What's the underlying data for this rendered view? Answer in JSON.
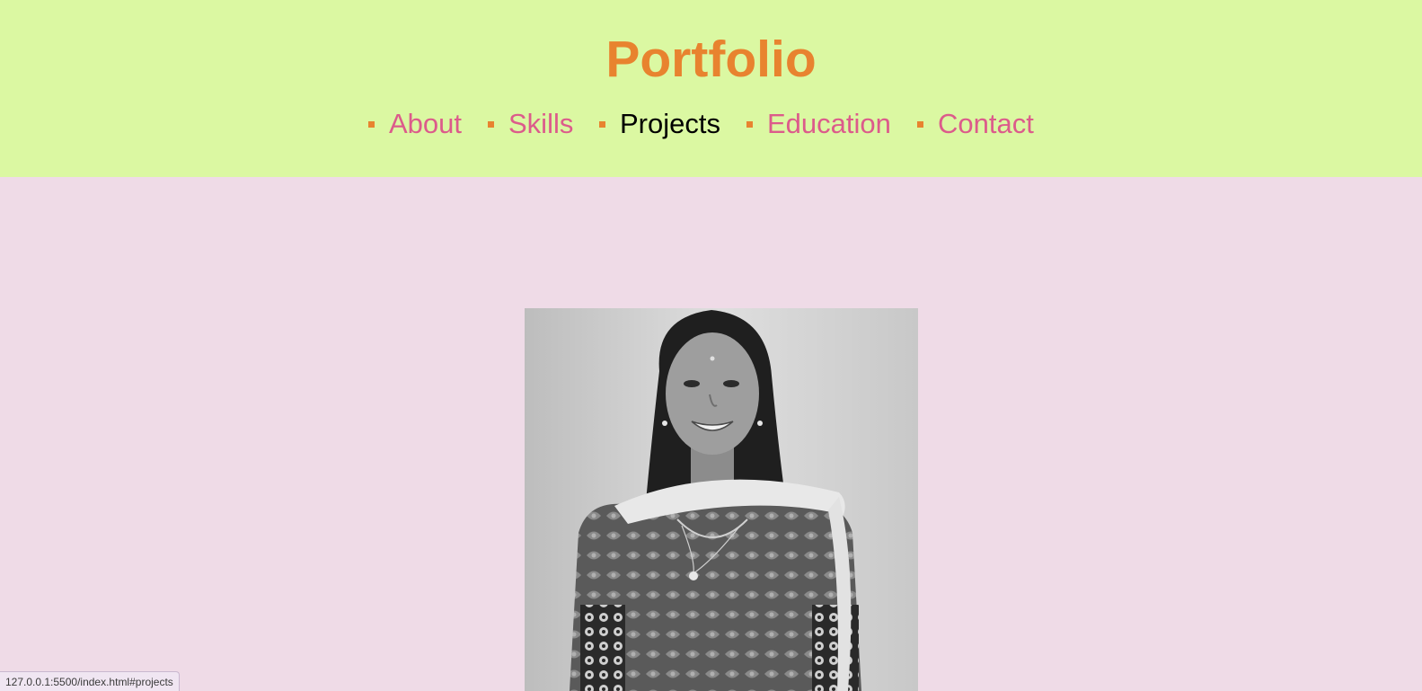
{
  "header": {
    "title": "Portfolio",
    "nav": [
      {
        "label": "About",
        "active": false
      },
      {
        "label": "Skills",
        "active": false
      },
      {
        "label": "Projects",
        "active": true
      },
      {
        "label": "Education",
        "active": false
      },
      {
        "label": "Contact",
        "active": false
      }
    ]
  },
  "main": {
    "portrait_icon": "profile-photo"
  },
  "status_bar": {
    "url": "127.0.0.1:5500/index.html#projects"
  },
  "colors": {
    "header_bg": "#dbf8a2",
    "page_bg": "#efdbe7",
    "title": "#e8832f",
    "nav_link": "#dc5b8b",
    "nav_active": "#000000",
    "bullet": "#e8832f"
  }
}
